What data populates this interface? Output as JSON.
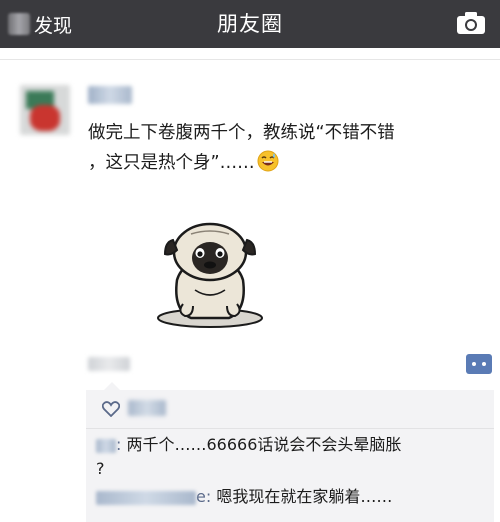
{
  "header": {
    "back_label": "发现",
    "title": "朋友圈"
  },
  "post": {
    "text_line1": "做完上下卷腹两千个，教练说“不错不错",
    "text_line2": "，这只是热个身”……"
  },
  "comments": [
    {
      "separator": ":",
      "text_line1": " 两千个……66666话说会不会头晕脑胀",
      "text_line2": "?"
    },
    {
      "separator": "e:",
      "text_line1": " 嗯我现在就在家躺着……"
    }
  ],
  "icons": {
    "camera": "camera-icon",
    "comment": "comment-icon",
    "like": "heart-icon",
    "emoji": "grinning-sweat-emoji-icon",
    "sticker": "pug-sticker"
  },
  "colors": {
    "topbar": "#3a3a3e",
    "name_link": "#5b6a8a",
    "comment_bg": "#f3f3f5"
  }
}
